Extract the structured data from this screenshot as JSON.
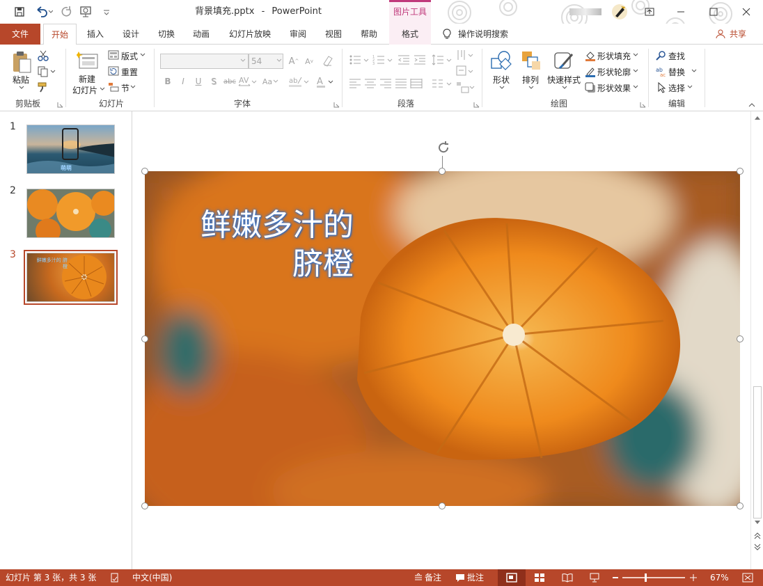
{
  "titlebar": {
    "filename": "背景填充.pptx",
    "separator": "-",
    "app": "PowerPoint",
    "context_group": "图片工具"
  },
  "tabs": [
    "文件",
    "开始",
    "插入",
    "设计",
    "切换",
    "动画",
    "幻灯片放映",
    "审阅",
    "视图",
    "帮助",
    "格式"
  ],
  "tell_me": "操作说明搜索",
  "share": "共享",
  "ribbon": {
    "clipboard": {
      "label": "剪贴板",
      "paste": "粘贴"
    },
    "slides": {
      "label": "幻灯片",
      "new_slide_1": "新建",
      "new_slide_2": "幻灯片",
      "layout": "版式",
      "reset": "重置",
      "section": "节"
    },
    "font": {
      "label": "字体",
      "size": "54",
      "bold": "B",
      "italic": "I",
      "underline": "U",
      "shadow": "S",
      "strike": "abc",
      "aa": "Aa"
    },
    "paragraph": {
      "label": "段落"
    },
    "drawing": {
      "label": "绘图",
      "shapes": "形状",
      "arrange": "排列",
      "quick_styles": "快速样式",
      "fill": "形状填充",
      "outline": "形状轮廓",
      "effects": "形状效果"
    },
    "editing": {
      "label": "编辑",
      "find": "查找",
      "replace": "替换",
      "select": "选择"
    }
  },
  "slides": [
    {
      "num": "1",
      "caption": "萌萌"
    },
    {
      "num": "2"
    },
    {
      "num": "3",
      "caption": "鲜嫩多汁的 脐橙"
    }
  ],
  "slide": {
    "title_line1": "鲜嫩多汁的",
    "title_line2": "脐橙"
  },
  "status": {
    "slide_info": "幻灯片 第 3 张，共 3 张",
    "language": "中文(中国)",
    "notes": "备注",
    "comments": "批注",
    "zoom": "67%"
  },
  "colors": {
    "accent": "#b7472a",
    "context": "#c0397b"
  }
}
